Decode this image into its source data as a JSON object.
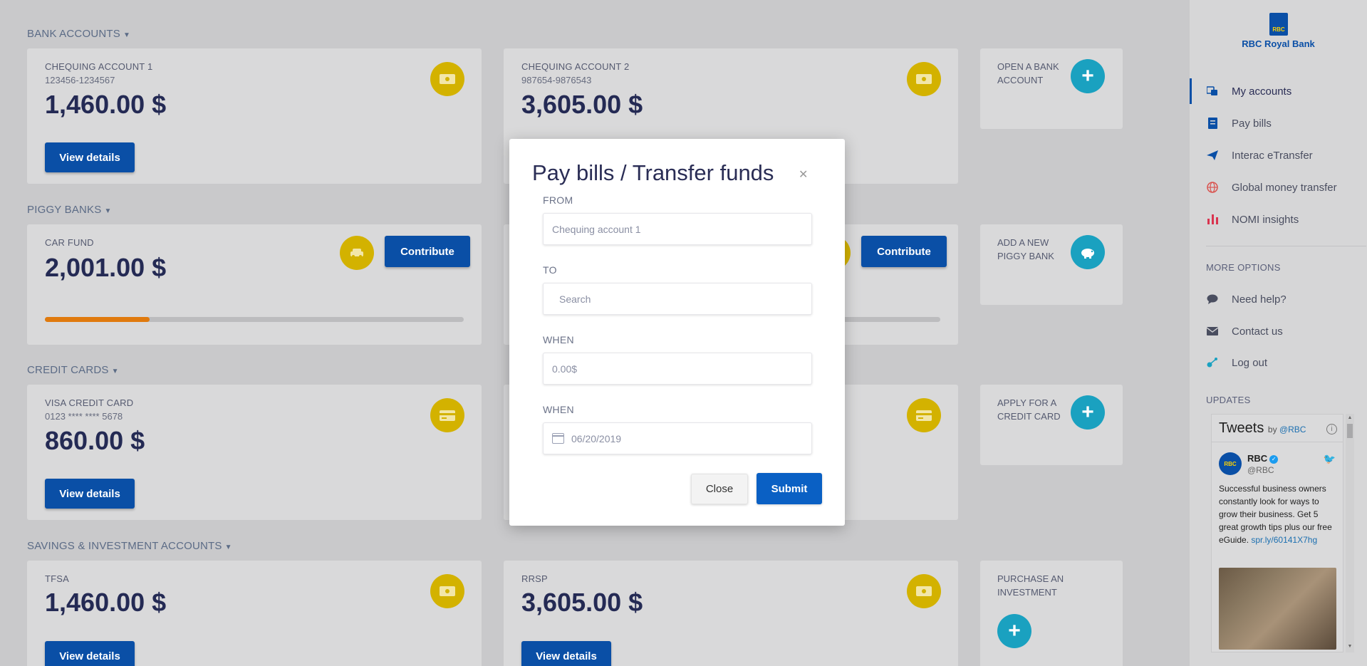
{
  "sections": {
    "bank_accounts": "BANK ACCOUNTS",
    "piggy_banks": "PIGGY BANKS",
    "credit_cards": "CREDIT CARDS",
    "savings": "SAVINGS & INVESTMENT ACCOUNTS"
  },
  "bank_accounts": [
    {
      "name": "CHEQUING ACCOUNT 1",
      "number": "123456-1234567",
      "balance": "1,460.00 $",
      "button": "View details"
    },
    {
      "name": "CHEQUING ACCOUNT 2",
      "number": "987654-9876543",
      "balance": "3,605.00 $"
    }
  ],
  "open_account": "OPEN A BANK ACCOUNT",
  "piggy_banks": [
    {
      "name": "CAR FUND",
      "balance": "2,001.00 $",
      "button": "Contribute",
      "progress": 0.25,
      "color": "#e07a0e"
    },
    {
      "button": "Contribute",
      "progress": 0.75,
      "color": "#5a9d1a"
    }
  ],
  "add_piggy": "ADD A NEW PIGGY BANK",
  "credit_cards": [
    {
      "name": "VISA CREDIT CARD",
      "number": "0123 **** **** 5678",
      "balance": "860.00 $",
      "button": "View details"
    }
  ],
  "apply_credit": "APPLY FOR A CREDIT CARD",
  "savings": [
    {
      "name": "TFSA",
      "balance": "1,460.00 $",
      "button": "View details"
    },
    {
      "name": "RRSP",
      "balance": "3,605.00 $",
      "button": "View details"
    }
  ],
  "purchase_investment": "PURCHASE AN INVESTMENT",
  "sidebar": {
    "brand": "RBC Royal Bank",
    "logo_text": "RBC",
    "nav": [
      {
        "label": "My accounts",
        "icon": "accounts-icon"
      },
      {
        "label": "Pay bills",
        "icon": "bill-icon"
      },
      {
        "label": "Interac eTransfer",
        "icon": "send-icon"
      },
      {
        "label": "Global money transfer",
        "icon": "globe-icon"
      },
      {
        "label": "NOMI insights",
        "icon": "chart-icon"
      }
    ],
    "more_options_title": "MORE OPTIONS",
    "more": [
      {
        "label": "Need help?",
        "icon": "chat-icon"
      },
      {
        "label": "Contact us",
        "icon": "mail-icon"
      },
      {
        "label": "Log out",
        "icon": "logout-icon"
      }
    ],
    "updates_title": "UPDATES"
  },
  "tweets": {
    "header": "Tweets",
    "by": "by",
    "by_handle": "@RBC",
    "author": "RBC",
    "handle": "@RBC",
    "text": "Successful business owners constantly look for ways to grow their business. Get 5 great growth tips plus our free eGuide.",
    "link": "spr.ly/60141X7hg"
  },
  "modal": {
    "title": "Pay bills / Transfer funds",
    "from_label": "FROM",
    "from_value": "Chequing account 1",
    "to_label": "TO",
    "to_placeholder": "Search",
    "amount_label": "WHEN",
    "amount_placeholder": "0.00$",
    "date_label": "WHEN",
    "date_value": "06/20/2019",
    "close": "Close",
    "submit": "Submit"
  },
  "colors": {
    "primary": "#0a4fa6",
    "accent_yellow": "#d3b200",
    "accent_teal": "#1aa1c0",
    "text_dark": "#2a2d55"
  }
}
